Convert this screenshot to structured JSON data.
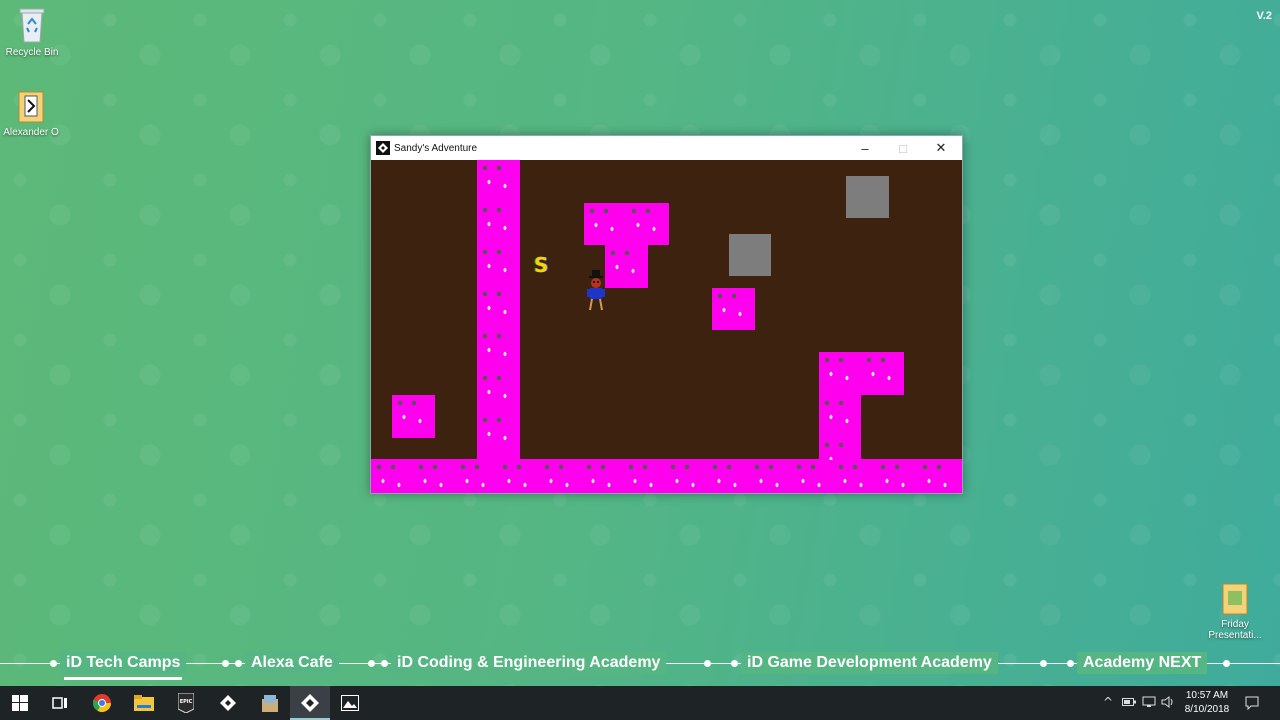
{
  "desktop": {
    "version": "V.2",
    "icons": [
      {
        "label": "Recycle Bin",
        "icon": "recycle-bin-icon"
      },
      {
        "label": "Alexander O",
        "icon": "folder-icon"
      },
      {
        "label": "Friday Presentati...",
        "icon": "folder-icon"
      }
    ]
  },
  "window": {
    "title": "Sandy's Adventure",
    "icon": "game-maker-icon",
    "controls": {
      "minimize": "–",
      "maximize": "□",
      "close": "✕"
    }
  },
  "game": {
    "background_color": "#3d2210",
    "tile_color": "#ff00ee",
    "block_color": "#7d7d7d",
    "coin_glyph": "S",
    "character": "player-character"
  },
  "banner": {
    "items": [
      {
        "label": "iD Tech Camps",
        "active": true
      },
      {
        "label": "Alexa Cafe",
        "active": false
      },
      {
        "label": "iD Coding & Engineering Academy",
        "active": false
      },
      {
        "label": "iD Game Development Academy",
        "active": false
      },
      {
        "label": "Academy NEXT",
        "active": false
      }
    ]
  },
  "taskbar": {
    "start": "windows-start-icon",
    "pinned": [
      {
        "name": "task-view-icon"
      },
      {
        "name": "chrome-icon"
      },
      {
        "name": "file-explorer-icon"
      },
      {
        "name": "epic-games-icon",
        "label": "EPIC"
      },
      {
        "name": "game-maker-icon"
      },
      {
        "name": "installer-icon"
      },
      {
        "name": "game-maker-running-icon",
        "active": true
      },
      {
        "name": "photos-icon"
      }
    ],
    "clock": {
      "time": "10:57 AM",
      "date": "8/10/2018"
    },
    "tray": {
      "chevron": "^",
      "notifications": "notifications-icon"
    }
  }
}
